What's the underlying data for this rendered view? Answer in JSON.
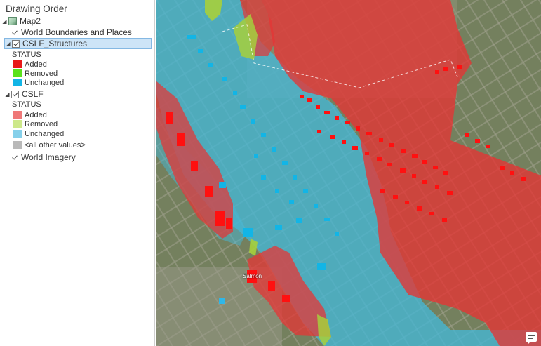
{
  "panel": {
    "title": "Drawing Order",
    "map": {
      "label": "Map2"
    },
    "layers": [
      {
        "label": "World Boundaries and Places",
        "checked": true
      },
      {
        "label": "CSLF_Structures",
        "checked": true,
        "selected": true,
        "status_header": "STATUS",
        "legend": [
          {
            "label": "Added",
            "color": "#e81919"
          },
          {
            "label": "Removed",
            "color": "#59e21b"
          },
          {
            "label": "Unchanged",
            "color": "#12b5e6"
          }
        ]
      },
      {
        "label": "CSLF",
        "checked": true,
        "status_header": "STATUS",
        "legend": [
          {
            "label": "Added",
            "color": "#ef7878"
          },
          {
            "label": "Removed",
            "color": "#cde88a"
          },
          {
            "label": "Unchanged",
            "color": "#86d0ea"
          },
          {
            "label": "<all other values>",
            "color": "#b9b9b9"
          }
        ]
      },
      {
        "label": "World Imagery",
        "checked": true
      }
    ]
  },
  "map": {
    "place_label": "Salmon",
    "colors": {
      "imagery": "#6f7c5c",
      "flood_added": "#e53535",
      "flood_unchanged": "#45b7d6",
      "flood_removed": "#a6cf3c"
    }
  }
}
